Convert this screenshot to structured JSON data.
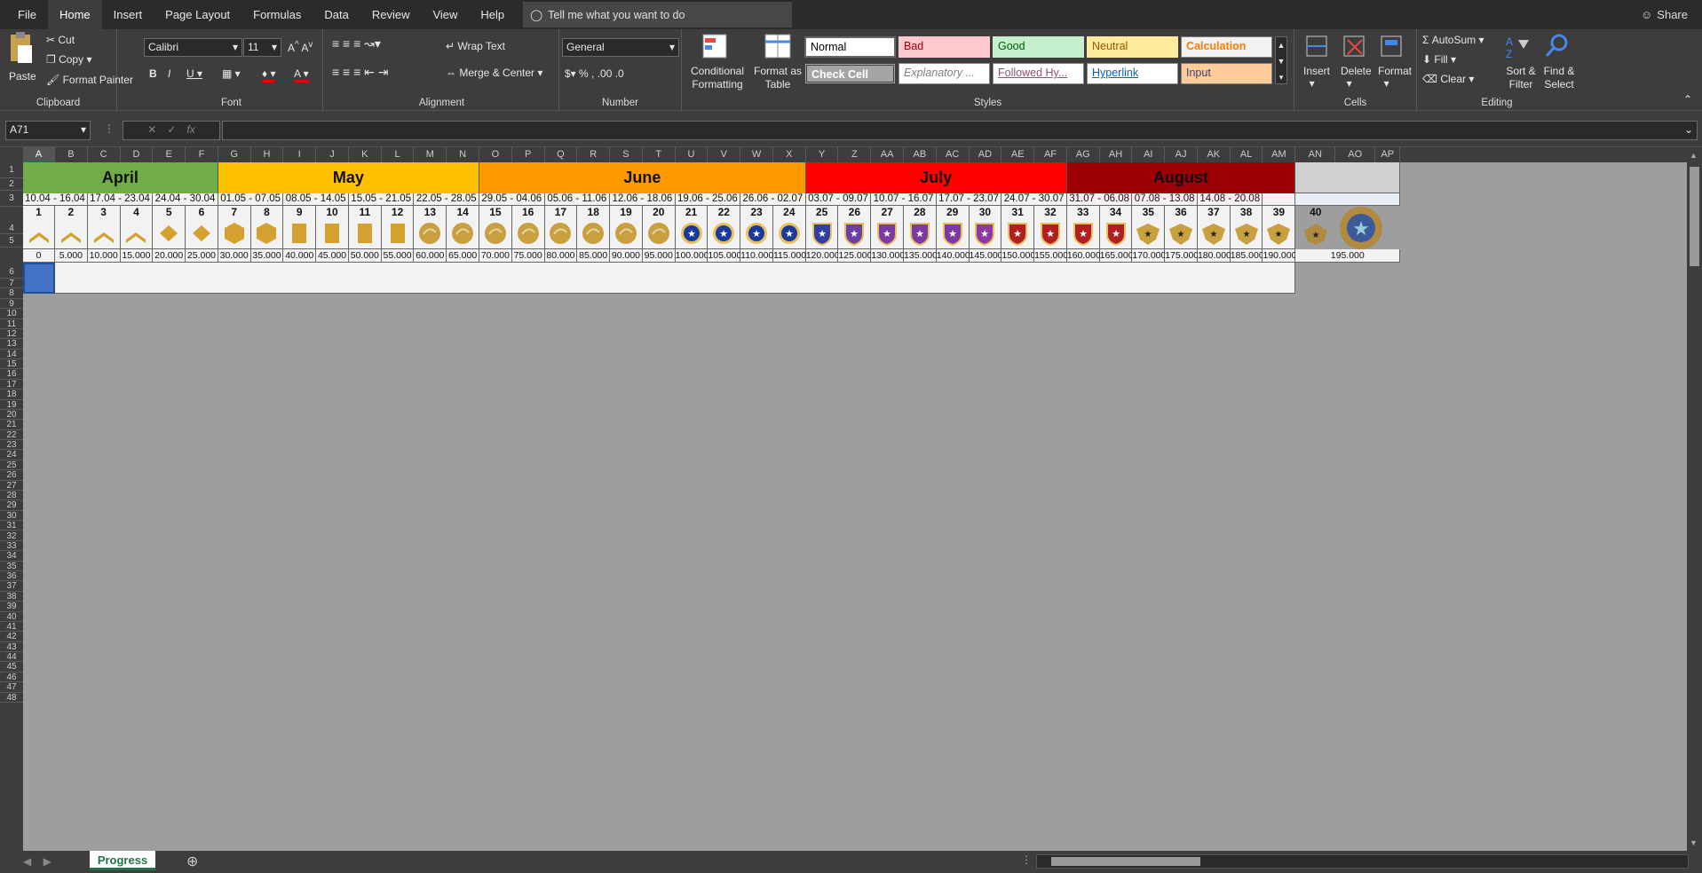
{
  "menu": {
    "tabs": [
      "File",
      "Home",
      "Insert",
      "Page Layout",
      "Formulas",
      "Data",
      "Review",
      "View",
      "Help"
    ],
    "active": "Home",
    "tell_me": "Tell me what you want to do",
    "share": "Share"
  },
  "ribbon": {
    "clipboard": {
      "label": "Clipboard",
      "paste": "Paste",
      "cut": "Cut",
      "copy": "Copy",
      "format_painter": "Format Painter"
    },
    "font": {
      "label": "Font",
      "name": "Calibri",
      "size": "11"
    },
    "alignment": {
      "label": "Alignment",
      "wrap": "Wrap Text",
      "merge": "Merge & Center"
    },
    "number": {
      "label": "Number",
      "format": "General"
    },
    "styles": {
      "label": "Styles",
      "cond": "Conditional Formatting",
      "fmt_table": "Format as Table",
      "normal": "Normal",
      "bad": "Bad",
      "good": "Good",
      "neutral": "Neutral",
      "calculation": "Calculation",
      "check": "Check Cell",
      "explanatory": "Explanatory ...",
      "followed": "Followed Hy...",
      "hyperlink": "Hyperlink",
      "input": "Input"
    },
    "cells": {
      "label": "Cells",
      "insert": "Insert",
      "delete": "Delete",
      "format": "Format"
    },
    "editing": {
      "label": "Editing",
      "autosum": "AutoSum",
      "fill": "Fill",
      "clear": "Clear",
      "sort": "Sort & Filter",
      "find": "Find & Select"
    }
  },
  "formula_bar": {
    "name_box": "A71",
    "fx": "fx",
    "value": ""
  },
  "columns": [
    "A",
    "B",
    "C",
    "D",
    "E",
    "F",
    "G",
    "H",
    "I",
    "J",
    "K",
    "L",
    "M",
    "N",
    "O",
    "P",
    "Q",
    "R",
    "S",
    "T",
    "U",
    "V",
    "W",
    "X",
    "Y",
    "Z",
    "AA",
    "AB",
    "AC",
    "AD",
    "AE",
    "AF",
    "AG",
    "AH",
    "AI",
    "AJ",
    "AK",
    "AL",
    "AM",
    "AN",
    "AO",
    "AP"
  ],
  "rows": [
    "1",
    "2",
    "3",
    "4",
    "5",
    "6",
    "7",
    "8",
    "9",
    "10",
    "11",
    "12",
    "13",
    "14",
    "15",
    "16",
    "17",
    "18",
    "19",
    "20",
    "21",
    "22",
    "23",
    "24",
    "25",
    "26",
    "27",
    "28",
    "29",
    "30",
    "31",
    "32",
    "33",
    "34",
    "35",
    "36",
    "37",
    "38",
    "39",
    "40",
    "41",
    "42",
    "43",
    "44",
    "45",
    "46",
    "47",
    "48"
  ],
  "months": [
    {
      "name": "April",
      "color": "#70ad47"
    },
    {
      "name": "May",
      "color": "#ffc000"
    },
    {
      "name": "June",
      "color": "#ff9900"
    },
    {
      "name": "July",
      "color": "#ff0000"
    },
    {
      "name": "August",
      "color": "#9c0006"
    }
  ],
  "weeks": [
    "10.04 - 16.04",
    "17.04 - 23.04",
    "24.04 - 30.04",
    "01.05 - 07.05",
    "08.05 - 14.05",
    "15.05 - 21.05",
    "22.05 - 28.05",
    "29.05 - 04.06",
    "05.06 - 11.06",
    "12.06 - 18.06",
    "19.06 - 25.06",
    "26.06 - 02.07",
    "03.07 - 09.07",
    "10.07 - 16.07",
    "17.07 - 23.07",
    "24.07 - 30.07",
    "31.07 - 06.08",
    "07.08 - 13.08",
    "14.08 - 20.08"
  ],
  "levels": [
    "1",
    "2",
    "3",
    "4",
    "5",
    "6",
    "7",
    "8",
    "9",
    "10",
    "11",
    "12",
    "13",
    "14",
    "15",
    "16",
    "17",
    "18",
    "19",
    "20",
    "21",
    "22",
    "23",
    "24",
    "25",
    "26",
    "27",
    "28",
    "29",
    "30",
    "31",
    "32",
    "33",
    "34",
    "35",
    "36",
    "37",
    "38",
    "39",
    "40"
  ],
  "xp": [
    "0",
    "5.000",
    "10.000",
    "15.000",
    "20.000",
    "25.000",
    "30.000",
    "35.000",
    "40.000",
    "45.000",
    "50.000",
    "55.000",
    "60.000",
    "65.000",
    "70.000",
    "75.000",
    "80.000",
    "85.000",
    "90.000",
    "95.000",
    "100.000",
    "105.000",
    "110.000",
    "115.000",
    "120.000",
    "125.000",
    "130.000",
    "135.000",
    "140.000",
    "145.000",
    "150.000",
    "155.000",
    "160.000",
    "165.000",
    "170.000",
    "175.000",
    "180.000",
    "185.000",
    "190.000",
    "195.000"
  ],
  "rank_icons": [
    "chevron-1-icon",
    "chevron-2-icon",
    "chevron-3-icon",
    "chevron-4-icon",
    "diamond-1-icon",
    "diamond-2-icon",
    "hex-1-icon",
    "hex-2-icon",
    "bar-1-icon",
    "bar-2-icon",
    "bar-3-icon",
    "bar-4-icon",
    "eagle-1-icon",
    "eagle-2-icon",
    "eagle-wreath-1-icon",
    "eagle-wreath-2-icon",
    "eagle-star-1-icon",
    "eagle-star-2-icon",
    "globe-1-icon",
    "globe-2-icon",
    "blue-star-1-icon",
    "blue-star-2-icon",
    "blue-star-3-icon",
    "blue-shield-icon",
    "purple-shield-1-icon",
    "purple-shield-2-icon",
    "purple-shield-3-icon",
    "purple-shield-4-icon",
    "purple-shield-5-icon",
    "purple-shield-6-icon",
    "red-shield-1-icon",
    "red-shield-2-icon",
    "red-shield-3-icon",
    "red-shield-4-icon",
    "gold-eagle-1-icon",
    "gold-eagle-2-icon",
    "gold-eagle-3-icon",
    "gold-eagle-4-icon",
    "gold-eagle-5-icon",
    "gold-eagle-6-icon"
  ],
  "sheet": {
    "tab": "Progress"
  }
}
